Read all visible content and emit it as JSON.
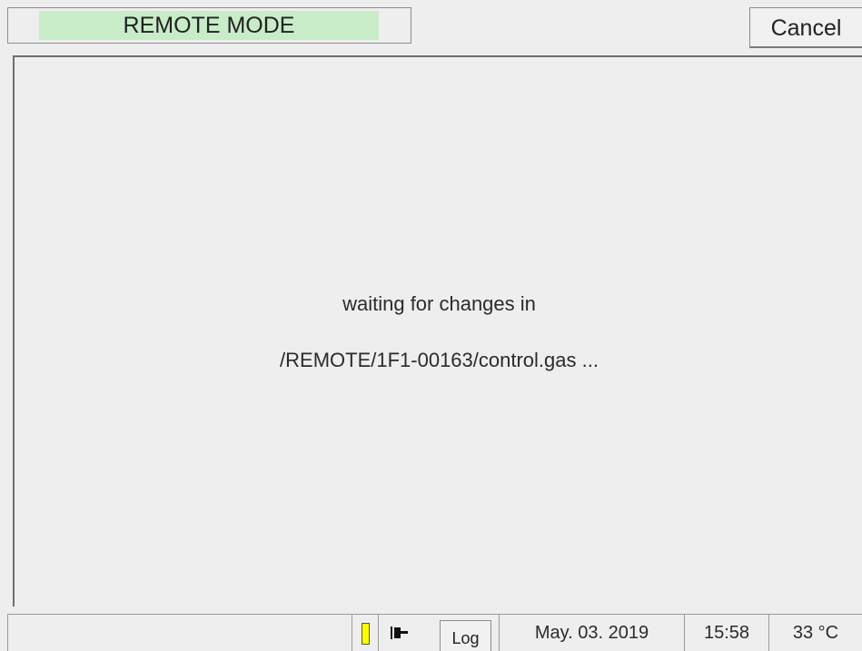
{
  "header": {
    "mode_label": "REMOTE MODE",
    "cancel_label": "Cancel",
    "mode_color": "#c8ecc8"
  },
  "main": {
    "message_line1": "waiting for changes in",
    "message_line2": "/REMOTE/1F1-00163/control.gas ..."
  },
  "statusbar": {
    "battery_icon": "battery-icon",
    "battery_color": "#ffff00",
    "plug_icon": "power-plug-icon",
    "log_label": "Log",
    "date": "May. 03. 2019",
    "time": "15:58",
    "temperature": "33 °C"
  }
}
